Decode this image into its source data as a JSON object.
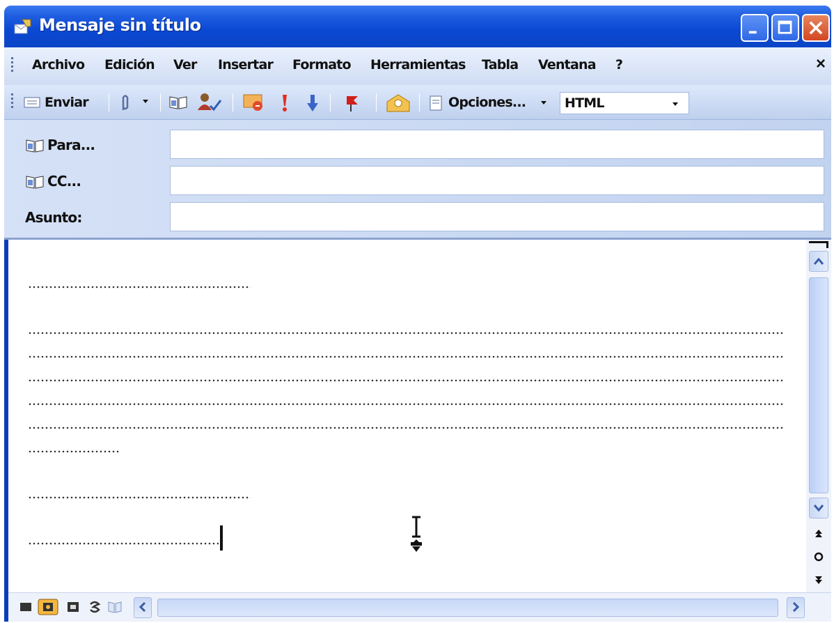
{
  "window": {
    "title": "Mensaje sin título"
  },
  "menu": {
    "items": [
      {
        "label": "Archivo",
        "accel": "A"
      },
      {
        "label": "Edición",
        "accel": "E"
      },
      {
        "label": "Ver",
        "accel": "V"
      },
      {
        "label": "Insertar",
        "accel": "I"
      },
      {
        "label": "Formato",
        "accel": "F"
      },
      {
        "label": "Herramientas",
        "accel": "H"
      },
      {
        "label": "Tabla",
        "accel": "l"
      },
      {
        "label": "Ventana",
        "accel": "n"
      },
      {
        "label": "?",
        "accel": "?"
      }
    ],
    "close_glyph": "×"
  },
  "toolbar": {
    "send_label": "Enviar",
    "options_label": "Opciones...",
    "format_value": "HTML",
    "icons": [
      "send-icon",
      "attach-icon",
      "address-book-icon",
      "check-names-icon",
      "signature-icon",
      "high-importance-icon",
      "low-importance-icon",
      "flag-icon",
      "permission-icon",
      "options-icon"
    ]
  },
  "fields": {
    "to_label": "Para...",
    "cc_label": "CC...",
    "subject_label": "Asunto:",
    "to_value": "",
    "cc_value": "",
    "subject_value": ""
  },
  "colors": {
    "titlebar": "#0b48d2",
    "close_button": "#d24622",
    "chrome": "#c2d3f0"
  }
}
